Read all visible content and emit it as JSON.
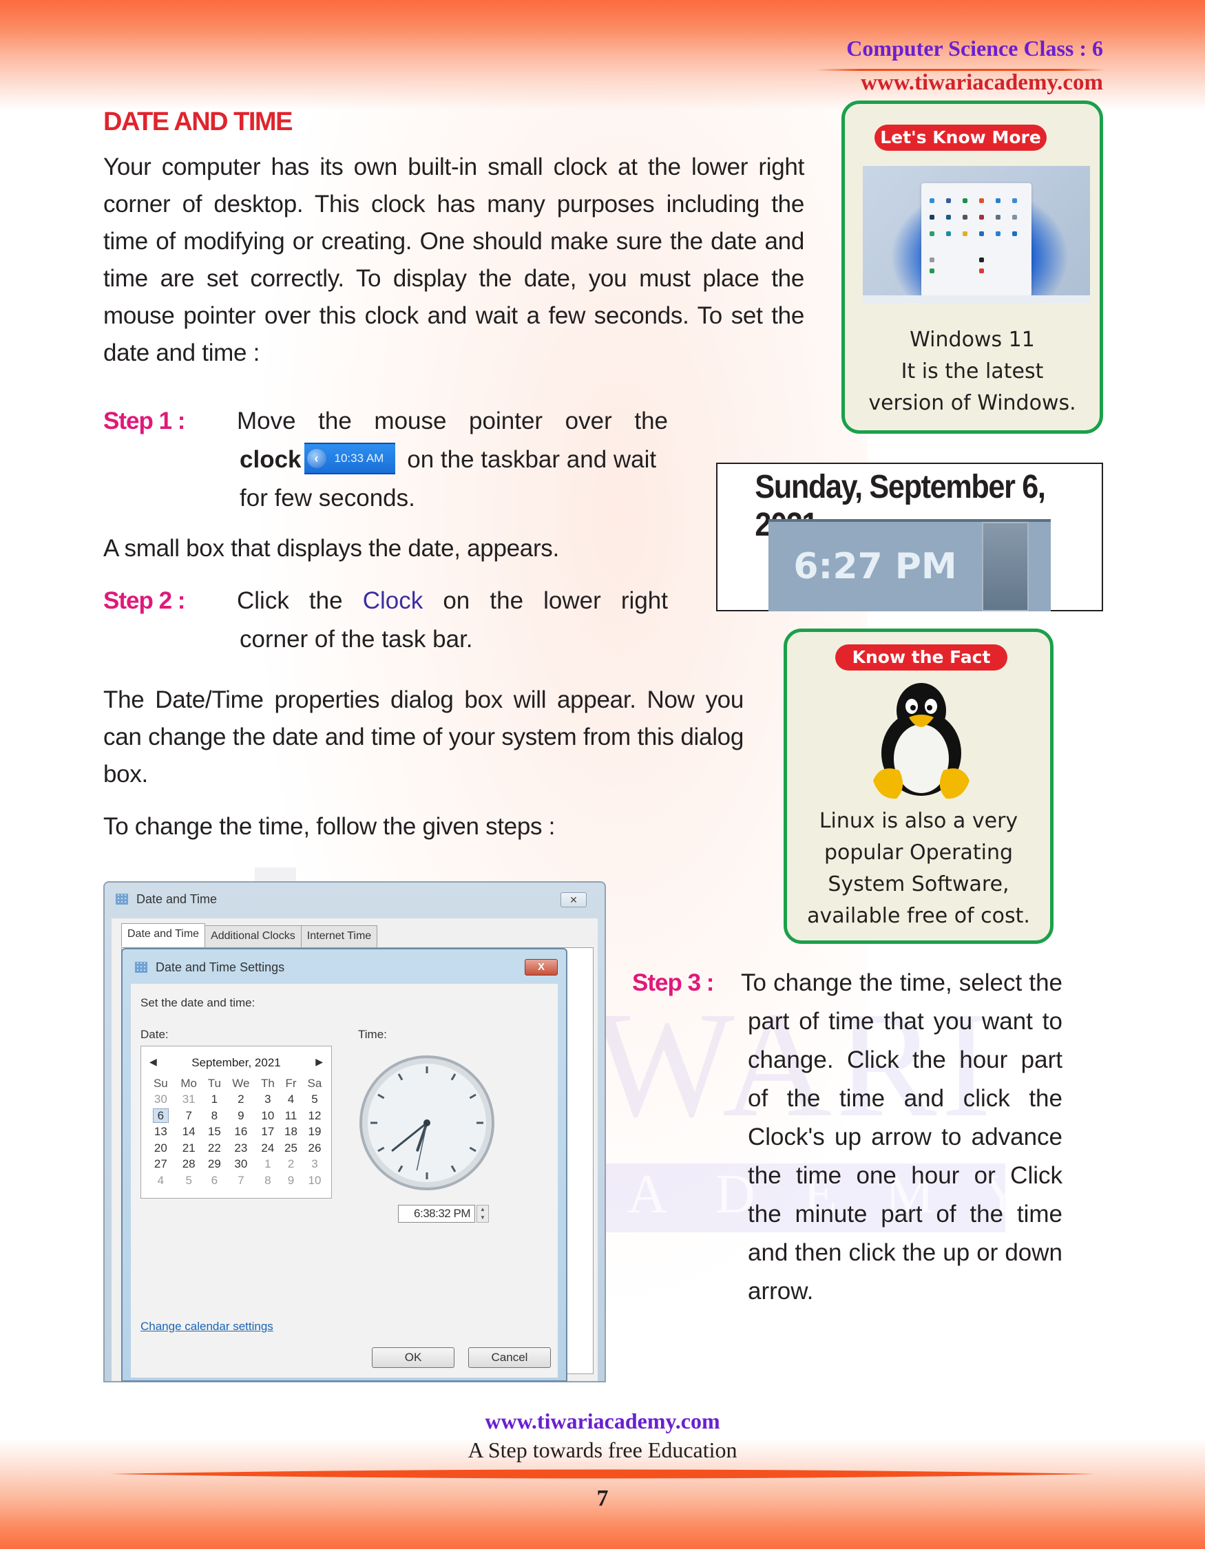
{
  "header": {
    "class_label": "Computer Science Class : 6",
    "website": "www.tiwariacademy.com"
  },
  "watermark": {
    "word1": "TIWARI",
    "word2": "ACADEMY"
  },
  "section": {
    "title": "DATE AND TIME",
    "intro": "Your computer has its own built-in small clock at the lower right corner of desktop. This clock has many purposes including the time of modifying or creating. One should make sure the date and time are set correctly. To display the date, you must place the mouse pointer over this clock and wait a few seconds. To set the date and time :"
  },
  "steps": [
    {
      "label": "Step 1 :",
      "text_before": "Move the mouse pointer over the",
      "bold_word": "clock",
      "text_after": "on the taskbar and wait for few seconds.",
      "taskbar_clock_time": "10:33 AM"
    },
    {
      "label": "Step 2 :",
      "text_before": "Click the",
      "link_word": "Clock",
      "text_after": "on the lower right corner of the task bar."
    },
    {
      "label": "Step 3 :",
      "text": "To change the time, select the part of time that you want to change. Click the hour part of the time and click the Clock's up arrow to advance the time one hour or Click the minute part of the time and then click the up or down arrow."
    }
  ],
  "paragraphs": {
    "small_box": "A small box that displays the date, appears.",
    "dialog_appears": "The Date/Time properties dialog box will appear. Now you can change the date and time of your system from this dialog box.",
    "change_time": "To change the time, follow the given steps :"
  },
  "know_more_box": {
    "badge": "Let's Know More",
    "caption_line1": "Windows 11",
    "caption_line2": "It is the latest",
    "caption_line3": "version of Windows.",
    "image_icon": "windows-11-start-menu"
  },
  "date_tooltip": {
    "date": "Sunday, September 6, 2021",
    "time": "6:27 PM"
  },
  "know_fact_box": {
    "badge": "Know the Fact",
    "caption_line1": "Linux is also a very",
    "caption_line2": "popular Operating",
    "caption_line3": "System Software,",
    "caption_line4": "available free of cost.",
    "image_icon": "tux-penguin"
  },
  "dialog": {
    "outer_title": "Date and Time",
    "tabs": [
      "Date and Time",
      "Additional Clocks",
      "Internet Time"
    ],
    "inner_title": "Date and Time Settings",
    "set_label": "Set the date and time:",
    "date_label": "Date:",
    "time_label": "Time:",
    "calendar": {
      "month": "September, 2021",
      "weekdays": [
        "Su",
        "Mo",
        "Tu",
        "We",
        "Th",
        "Fr",
        "Sa"
      ],
      "weeks": [
        [
          "30",
          "31",
          "1",
          "2",
          "3",
          "4",
          "5"
        ],
        [
          "6",
          "7",
          "8",
          "9",
          "10",
          "11",
          "12"
        ],
        [
          "13",
          "14",
          "15",
          "16",
          "17",
          "18",
          "19"
        ],
        [
          "20",
          "21",
          "22",
          "23",
          "24",
          "25",
          "26"
        ],
        [
          "27",
          "28",
          "29",
          "30",
          "1",
          "2",
          "3"
        ],
        [
          "4",
          "5",
          "6",
          "7",
          "8",
          "9",
          "10"
        ]
      ],
      "selected_day": "6"
    },
    "analog_clock": {
      "hour": 6,
      "minute": 38,
      "second": 32
    },
    "time_value": "6:38:32 PM",
    "change_calendar_link": "Change calendar settings",
    "ok_label": "OK",
    "cancel_label": "Cancel"
  },
  "footer": {
    "website": "www.tiwariacademy.com",
    "tagline": "A Step towards free Education",
    "page_number": "7"
  }
}
